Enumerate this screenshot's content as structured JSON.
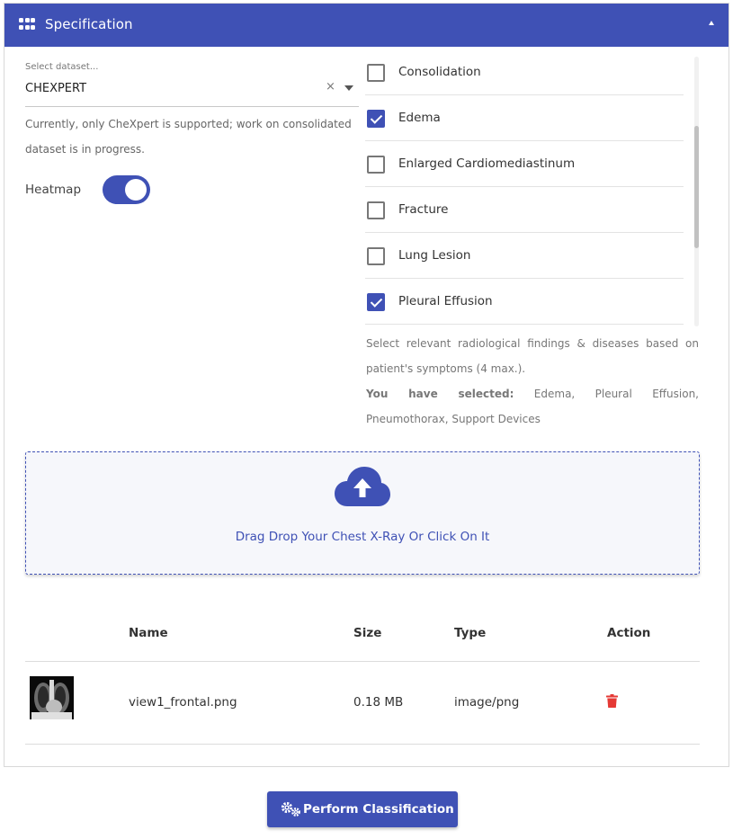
{
  "header": {
    "title": "Specification",
    "grid_icon": "grid-icon",
    "collapse_icon": "caret-up-icon"
  },
  "dataset": {
    "label": "Select dataset...",
    "value": "CHEXPERT",
    "clear": "×",
    "help": "Currently, only CheXpert is supported; work on consolidated dataset is in progress."
  },
  "heatmap": {
    "label": "Heatmap",
    "enabled": true
  },
  "findings": {
    "items": [
      {
        "label": "Consolidation",
        "checked": false
      },
      {
        "label": "Edema",
        "checked": true
      },
      {
        "label": "Enlarged Cardiomediastinum",
        "checked": false
      },
      {
        "label": "Fracture",
        "checked": false
      },
      {
        "label": "Lung Lesion",
        "checked": false
      },
      {
        "label": "Pleural Effusion",
        "checked": true
      }
    ],
    "help": "Select relevant radiological findings & diseases based on patient's symptoms (4 max.).",
    "selected_label": "You have selected:",
    "selected_value": " Edema, Pleural Effusion, Pneumothorax, Support Devices"
  },
  "dropzone": {
    "text": "Drag Drop Your Chest X-Ray Or Click On It",
    "icon": "cloud-upload-icon"
  },
  "table": {
    "headers": {
      "name": "Name",
      "size": "Size",
      "type": "Type",
      "action": "Action"
    },
    "rows": [
      {
        "name": "view1_frontal.png",
        "size": "0.18 MB",
        "type": "image/png",
        "action_icon": "trash-icon"
      }
    ]
  },
  "perform": {
    "label": "Perform Classification",
    "icon": "gears-icon"
  },
  "colors": {
    "accent": "#3f51b5",
    "delete": "#e53935"
  }
}
